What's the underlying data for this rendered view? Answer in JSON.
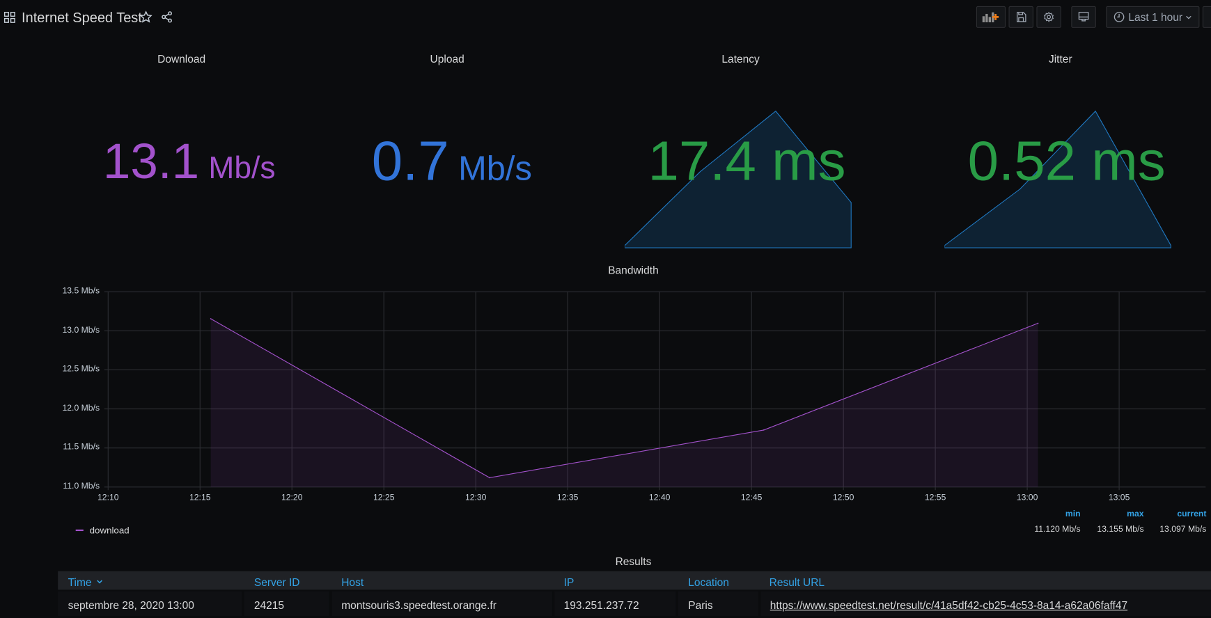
{
  "header": {
    "title": "Internet Speed Test",
    "time_range": "Last 1 hour"
  },
  "icons": {
    "dashboards": "grid-icon",
    "star": "star-icon",
    "share": "share-icon",
    "add_panel": "add-panel-icon",
    "save": "save-icon",
    "settings": "gear-icon",
    "tv": "monitor-icon",
    "clock": "clock-icon",
    "chevron": "chevron-down-icon"
  },
  "stats": [
    {
      "title": "Download",
      "value": "13.1",
      "unit": "Mb/s",
      "color": "#a352cc"
    },
    {
      "title": "Upload",
      "value": "0.7",
      "unit": "Mb/s",
      "color": "#3274d9"
    },
    {
      "title": "Latency",
      "value": "17.4 ms",
      "color": "#299c46",
      "sparkline": [
        0,
        0.55,
        1,
        0.32
      ]
    },
    {
      "title": "Jitter",
      "value": "0.52 ms",
      "color": "#299c46",
      "sparkline": [
        0,
        0.42,
        1,
        0
      ]
    }
  ],
  "chart_data": {
    "type": "area",
    "title": "Bandwidth",
    "y_ticks": [
      "13.5 Mb/s",
      "13.0 Mb/s",
      "12.5 Mb/s",
      "12.0 Mb/s",
      "11.5 Mb/s",
      "11.0 Mb/s"
    ],
    "x_ticks": [
      "12:10",
      "12:15",
      "12:20",
      "12:25",
      "12:30",
      "12:35",
      "12:40",
      "12:45",
      "12:50",
      "12:55",
      "13:00",
      "13:05"
    ],
    "ylim": [
      11.0,
      13.5
    ],
    "grid": true,
    "series": [
      {
        "name": "download",
        "color": "#a352cc",
        "x": [
          "12:15:35",
          "12:30:45",
          "12:45:40",
          "13:00:35"
        ],
        "values": [
          13.155,
          11.12,
          11.73,
          13.097
        ]
      }
    ],
    "legend": {
      "placement": "bottom",
      "headers": [
        "min",
        "max",
        "current"
      ],
      "values": [
        "11.120 Mb/s",
        "13.155 Mb/s",
        "13.097 Mb/s"
      ]
    }
  },
  "table": {
    "title": "Results",
    "columns": [
      "Time",
      "Server ID",
      "Host",
      "IP",
      "Location",
      "Result URL"
    ],
    "rows": [
      [
        "septembre 28, 2020 13:00",
        "24215",
        "montsouris3.speedtest.orange.fr",
        "193.251.237.72",
        "Paris",
        "https://www.speedtest.net/result/c/41a5df42-cb25-4c53-8a14-a62a06faff47"
      ]
    ]
  }
}
